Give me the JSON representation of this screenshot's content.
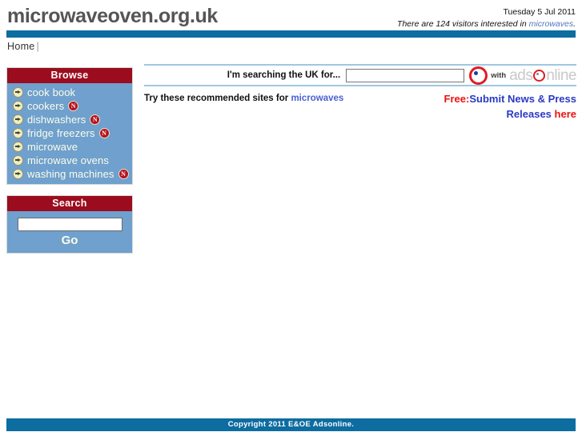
{
  "header": {
    "site_title": "microwaveoven.org.uk",
    "date": "Tuesday 5 Jul 2011",
    "visitors_prefix": "There are 124 visitors interested in ",
    "visitors_link": "microwaves",
    "visitors_suffix": ".",
    "visitor_count": 124
  },
  "nav": {
    "home_label": "Home",
    "separator": "|"
  },
  "sidebar": {
    "browse": {
      "title": "Browse",
      "items": [
        {
          "label": "cook book",
          "badge": ""
        },
        {
          "label": "cookers",
          "badge": "N"
        },
        {
          "label": "dishwashers",
          "badge": "N"
        },
        {
          "label": "fridge freezers",
          "badge": "N"
        },
        {
          "label": "microwave",
          "badge": ""
        },
        {
          "label": "microwave ovens",
          "badge": ""
        },
        {
          "label": "washing machines",
          "badge": "N"
        }
      ]
    },
    "search": {
      "title": "Search",
      "input_value": "",
      "input_placeholder": "",
      "go_label": "Go"
    }
  },
  "main": {
    "searchbar": {
      "label": "I'm searching the UK for...",
      "input_value": "",
      "input_placeholder": "",
      "with_label": "with",
      "brand_part1": "ads",
      "brand_part2": "nline"
    },
    "recommended": {
      "prefix": "Try these recommended sites for ",
      "link": "microwaves"
    },
    "promo": {
      "line1_red": "Free:",
      "line1_blue": "Submit News & Press",
      "line2_blue": "Releases ",
      "line2_red": "here"
    }
  },
  "footer": {
    "copyright": "Copyright 2011 E&OE Adsonline."
  },
  "colors": {
    "header_bar": "#0d6ca0",
    "panel_header": "#9b0d1e",
    "panel_body": "#6fa0ce",
    "link_blue": "#4a5fd0",
    "promo_red": "#ee1111",
    "promo_blue": "#2b39c4",
    "brand_red": "#e01b24"
  }
}
